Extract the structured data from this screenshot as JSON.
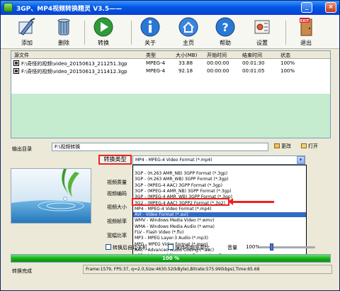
{
  "window": {
    "title": "3GP、MP4视频转换精灵 V3.5——"
  },
  "toolbar": {
    "items": [
      {
        "label": "添加",
        "icon": "add-file-icon"
      },
      {
        "label": "删除",
        "icon": "delete-icon"
      },
      {
        "label": "转换",
        "icon": "convert-play-icon"
      },
      {
        "label": "关于",
        "icon": "info-icon"
      },
      {
        "label": "主页",
        "icon": "home-icon"
      },
      {
        "label": "帮助",
        "icon": "help-icon"
      },
      {
        "label": "设置",
        "icon": "settings-icon"
      },
      {
        "label": "退出",
        "icon": "exit-icon"
      }
    ]
  },
  "filelist": {
    "columns": [
      "源文件",
      "类型",
      "大小(MB)",
      "开始时间",
      "结束时间",
      "状态"
    ],
    "rows": [
      [
        "F:\\奇怪的视频\\video_20150613_211251.3gp",
        "MPEG-4",
        "33.88",
        "00:00:00",
        "00:01:30",
        "100%"
      ],
      [
        "F:\\奇怪的视频\\video_20150613_211412.3gp",
        "MPEG-4",
        "92.18",
        "00:00:00",
        "00:01:05",
        "100%"
      ]
    ]
  },
  "output": {
    "label": "输出目录",
    "path": "F:\\视频转换",
    "change_label": "更改",
    "open_label": "打开"
  },
  "settings": {
    "format_type_label": "转换类型",
    "labels": [
      "视频质量",
      "视频编码",
      "视频大小",
      "视频帧率",
      "宽幅比率"
    ],
    "selected_format": "MP4 - MPEG-4 Video Format (*.mp4)",
    "dropdown_items": [
      "3GP - (H.263 AMR_NB) 3GPP Format (*.3gp)",
      "3GP - (H.263 AMR_WB) 3GPP Format (*.3gp)",
      "3GP - (MPEG-4 AAC) 3GPP Format (*.3gp)",
      "3GP - (MPEG-4 AMR_NB) 3GPP Format (*.3gp)",
      "3GP - (MPEG-4 AMR_WB) 3GPP Format (*.3gp)",
      "3G2 - (MPEG-4 AAC) 3GPP2 Format (*.3g2)",
      "MP4 - MPEG-4 Video Format (*.mp4)",
      "AVI - Video Format (*.avi)",
      "WMV - Windows Media Video (*.wmv)",
      "WMA - Windows Media Audio (*.wma)",
      "FLV - Flash Video (*.flv)",
      "MP3 - MPEG Layer-3 Audio (*.mp3)",
      "MPG - MPEG Video Format (*.mpg)",
      "AAC - Advanced Audio Coding (*.aac)",
      "ASF - Advanced Streaming Format (*.asf)"
    ],
    "selected_index": 7
  },
  "options": {
    "auto_shutdown": "转换后自动关机",
    "keep_aspect": "保持视频宽高比",
    "volume_label": "音量",
    "volume_value": "100%",
    "volume_level": 0.2
  },
  "progress": {
    "text": "100 %",
    "percent": 100
  },
  "status": {
    "left": "转换完成",
    "right": "Frame:1579, FPS:37, q=2.0,Size:4630.52(kByte),Bitrate:575.99(kbps),Time:65.68"
  },
  "colors": {
    "accent": "#0058e6",
    "progress": "#15b21a",
    "highlight": "#ee2222"
  }
}
